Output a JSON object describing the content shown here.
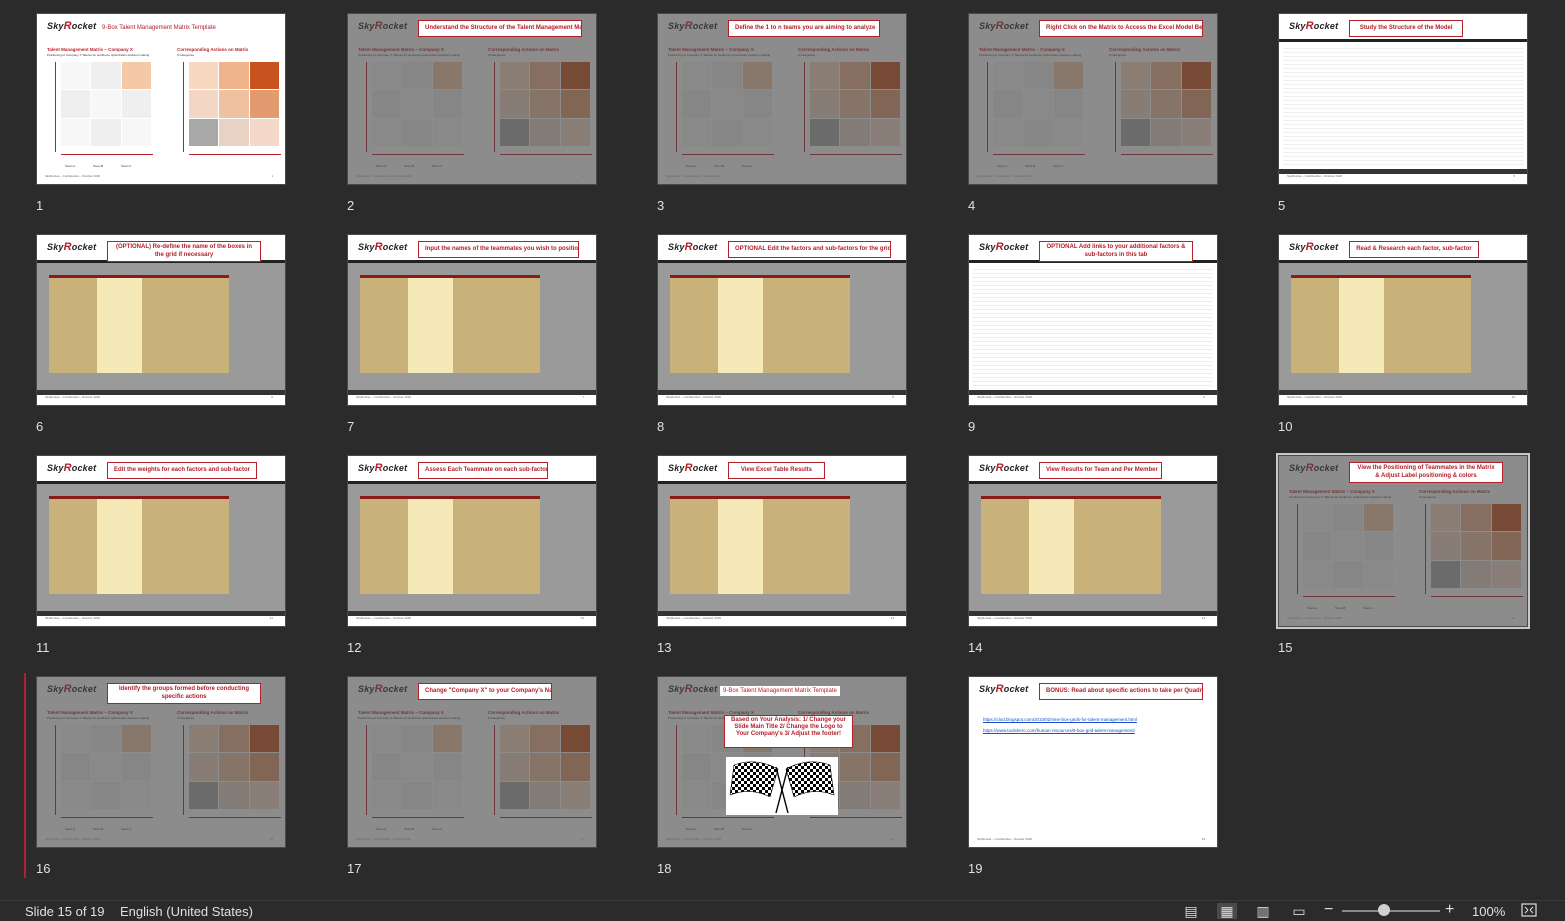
{
  "slides": [
    {
      "num": "1",
      "kind": "matrix",
      "title": "9-Box Talent Management Matrix Template",
      "dim": false
    },
    {
      "num": "2",
      "kind": "matrix",
      "banner": "Understand the Structure of the Talent Management Matrix",
      "dim": true
    },
    {
      "num": "3",
      "kind": "matrix",
      "banner": "Define the 1 to n teams you are aiming to analyze",
      "dim": true
    },
    {
      "num": "4",
      "kind": "matrix",
      "banner": "Right Click on the Matrix to Access the Excel Model Behind",
      "dim": true
    },
    {
      "num": "5",
      "kind": "excel-white",
      "banner": "Study the Structure of the Model",
      "dim": false
    },
    {
      "num": "6",
      "kind": "excel",
      "banner": "(OPTIONAL) Re-define the name of the boxes in the grid if necessary",
      "dim": false
    },
    {
      "num": "7",
      "kind": "excel",
      "banner": "Input the names of the teammates you wish to position",
      "dim": false
    },
    {
      "num": "8",
      "kind": "excel",
      "banner": "OPTIONAL Edit the factors and sub-factors for the grid",
      "dim": false
    },
    {
      "num": "9",
      "kind": "excel-white",
      "banner": "OPTIONAL Add links to your additional factors & sub-factors in this tab",
      "dim": false
    },
    {
      "num": "10",
      "kind": "excel",
      "banner": "Read & Research each factor, sub-factor",
      "dim": false
    },
    {
      "num": "11",
      "kind": "excel",
      "banner": "Edit the weights for each factors and sub-factor",
      "dim": false
    },
    {
      "num": "12",
      "kind": "excel",
      "banner": "Assess Each Teammate on each sub-factor",
      "dim": false
    },
    {
      "num": "13",
      "kind": "excel",
      "banner": "View Excel Table Results",
      "dim": false
    },
    {
      "num": "14",
      "kind": "excel",
      "banner": "View Results for Team and Per Member",
      "dim": false
    },
    {
      "num": "15",
      "kind": "matrix",
      "banner": "View the Positioning of Teammates in the Matrix & Adjust Label positioning & colors",
      "dim": true
    },
    {
      "num": "16",
      "kind": "matrix",
      "banner": "Identify the groups formed before conducting specific actions",
      "dim": true
    },
    {
      "num": "17",
      "kind": "matrix",
      "banner": "Change \"Company X\" to your Company's Name",
      "dim": true
    },
    {
      "num": "18",
      "kind": "finish",
      "title": "9-Box Talent Management Matrix Template",
      "banner": "Based on Your Analysis: 1/ Change your Slide Main Title 2/ Change the Logo to Your Company's 3/ Adjust the footer!",
      "dim": true
    },
    {
      "num": "19",
      "kind": "links",
      "banner": "BONUS: Read about specific actions to take per Quadrant",
      "links": [
        "https://clod.blogspot.com/2010/02/nine-box-grids-for-talent-management.html",
        "https://www.toolshero.com/human-resources/9-box-grid-talent-management/"
      ],
      "dim": false
    }
  ],
  "matrix": {
    "left_title": "Talent Management Matrix – Company X",
    "left_sub": "Positioning of Company X Talents for workforce optimization decision making",
    "right_title": "Corresponding Actions on Matrix",
    "right_sub": "9 Categories",
    "legend": [
      "Team A",
      "Team B",
      "Team C"
    ]
  },
  "logo": {
    "text": "Sky",
    "accent": "R",
    "rest": "ocket"
  },
  "footer": "SkyRocket – Confidential – October 2020",
  "status": {
    "slide": "Slide 15 of 19",
    "language": "English (United States)",
    "zoom": "100%",
    "zoom_fraction": 0.43
  },
  "icons": {
    "normal": "normal-view-icon",
    "sorter": "slide-sorter-icon",
    "reading": "reading-view-icon",
    "slideshow": "slideshow-icon",
    "fit": "fit-to-window-icon"
  }
}
